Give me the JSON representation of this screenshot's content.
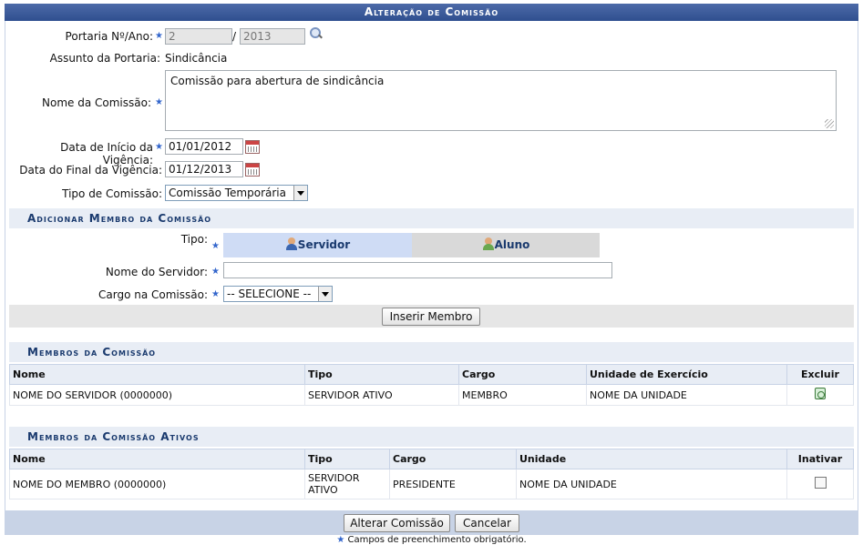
{
  "header": {
    "title": "Alteração de Comissão"
  },
  "form": {
    "portaria_label": "Portaria Nº/Ano:",
    "portaria_num": "2",
    "portaria_sep": "/",
    "portaria_ano": "2013",
    "assunto_label": "Assunto da Portaria:",
    "assunto_value": "Sindicância",
    "nome_label": "Nome da Comissão:",
    "nome_value": "Comissão para abertura de sindicância",
    "inicio_label": "Data de Início da Vigência:",
    "inicio_value": "01/01/2012",
    "final_label": "Data do Final da Vigência:",
    "final_value": "01/12/2013",
    "tipo_label": "Tipo de Comissão:",
    "tipo_value": "Comissão Temporária",
    "req_star": "★"
  },
  "add_member": {
    "title": "Adicionar Membro da Comissão",
    "tipo_label": "Tipo:",
    "tabs": [
      {
        "label": "Servidor"
      },
      {
        "label": "Aluno"
      }
    ],
    "servidor_label": "Nome do Servidor:",
    "servidor_value": "",
    "cargo_label": "Cargo na Comissão:",
    "cargo_value": "-- SELECIONE --",
    "insert_button": "Inserir Membro"
  },
  "members": {
    "title": "Membros da Comissão",
    "columns": [
      "Nome",
      "Tipo",
      "Cargo",
      "Unidade de Exercício",
      "Excluir"
    ],
    "rows": [
      {
        "nome": "NOME DO SERVIDOR (0000000)",
        "tipo": "SERVIDOR ATIVO",
        "cargo": "MEMBRO",
        "unidade": "NOME DA UNIDADE"
      }
    ]
  },
  "active_members": {
    "title": "Membros da Comissão Ativos",
    "columns": [
      "Nome",
      "Tipo",
      "Cargo",
      "Unidade",
      "Inativar"
    ],
    "rows": [
      {
        "nome": "NOME DO MEMBRO (0000000)",
        "tipo_line1": "SERVIDOR",
        "tipo_line2": "ATIVO",
        "cargo": "PRESIDENTE",
        "unidade": "NOME DA UNIDADE"
      }
    ]
  },
  "footer": {
    "alterar_button": "Alterar Comissão",
    "cancelar_button": "Cancelar",
    "note": "Campos de preenchimento obrigatório."
  },
  "colors": {
    "header_bg": "#2f4f8f",
    "section_bg": "#e8edf5",
    "required_star": "#3366cc",
    "tab_active": "#cfdcf5",
    "tab_inactive": "#d9d9d9"
  }
}
